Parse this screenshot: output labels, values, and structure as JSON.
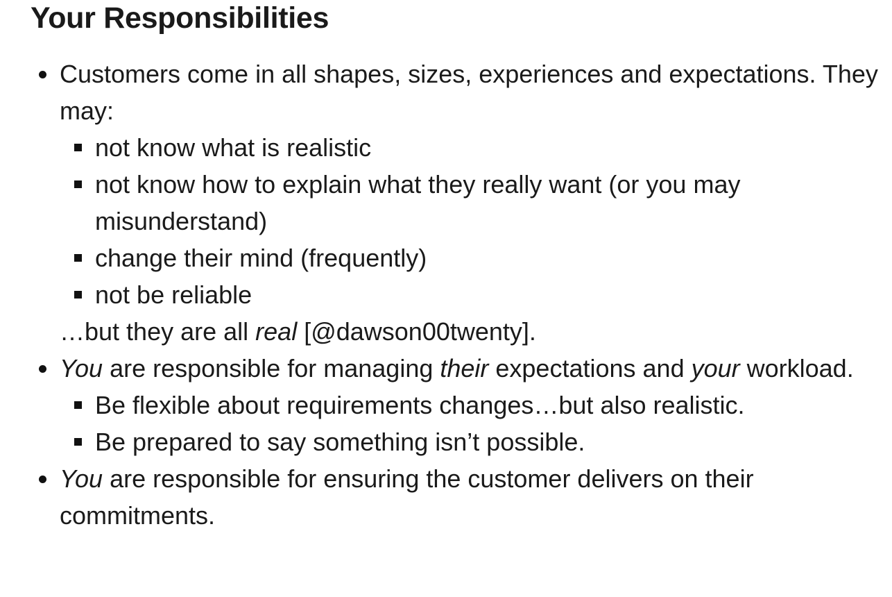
{
  "page": {
    "title": "Your Responsibilities"
  },
  "items": [
    {
      "intro": "Customers come in all shapes, sizes, experiences and expectations. They may:",
      "subitems": [
        "not know what is realistic",
        "not know how to explain what they really want (or you may misunderstand)",
        "change their mind (frequently)",
        "not be reliable"
      ],
      "outro": {
        "before": "…but they are all ",
        "emphasis": "real",
        "after": " [@dawson00twenty]."
      }
    },
    {
      "parts": {
        "e1": "You",
        "t1": " are responsible for managing ",
        "e2": "their",
        "t2": " expectations and ",
        "e3": "your",
        "t3": " workload."
      },
      "subitems": [
        "Be flexible about requirements changes…but also realistic.",
        "Be prepared to say something isn’t possible."
      ]
    },
    {
      "parts": {
        "e1": "You",
        "t1": " are responsible for ensuring the customer delivers on their commitments."
      }
    }
  ]
}
